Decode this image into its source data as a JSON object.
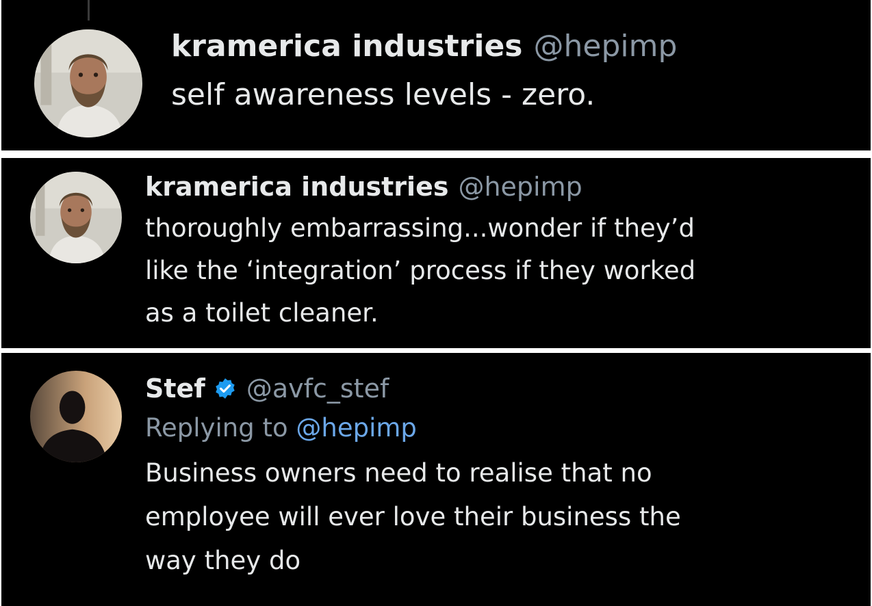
{
  "tweets": [
    {
      "name": "kramerica industries",
      "handle": "@hepimp",
      "text": "self awareness levels - zero.",
      "avatar_icon": "avatar-bearded-man"
    },
    {
      "name": "kramerica industries",
      "handle": "@hepimp",
      "text_lines": [
        "thoroughly embarrassing...wonder if they’d",
        "like the ‘integration’ process if they worked",
        "as a toilet cleaner."
      ],
      "avatar_icon": "avatar-bearded-man"
    },
    {
      "name": "Stef",
      "verified_icon": "verified-badge-icon",
      "handle": "@avfc_stef",
      "replying_prefix": "Replying to",
      "replying_handle": "@hepimp",
      "text_lines": [
        "Business owners need to realise that no",
        "employee will ever love their business the",
        "way they do"
      ],
      "avatar_icon": "avatar-silhouette"
    }
  ],
  "colors": {
    "background": "#000000",
    "separator": "#ffffff",
    "text_primary": "#e7e9ea",
    "text_secondary": "#8b98a5",
    "link": "#6ba7e8",
    "verified": "#1d9bf0"
  }
}
